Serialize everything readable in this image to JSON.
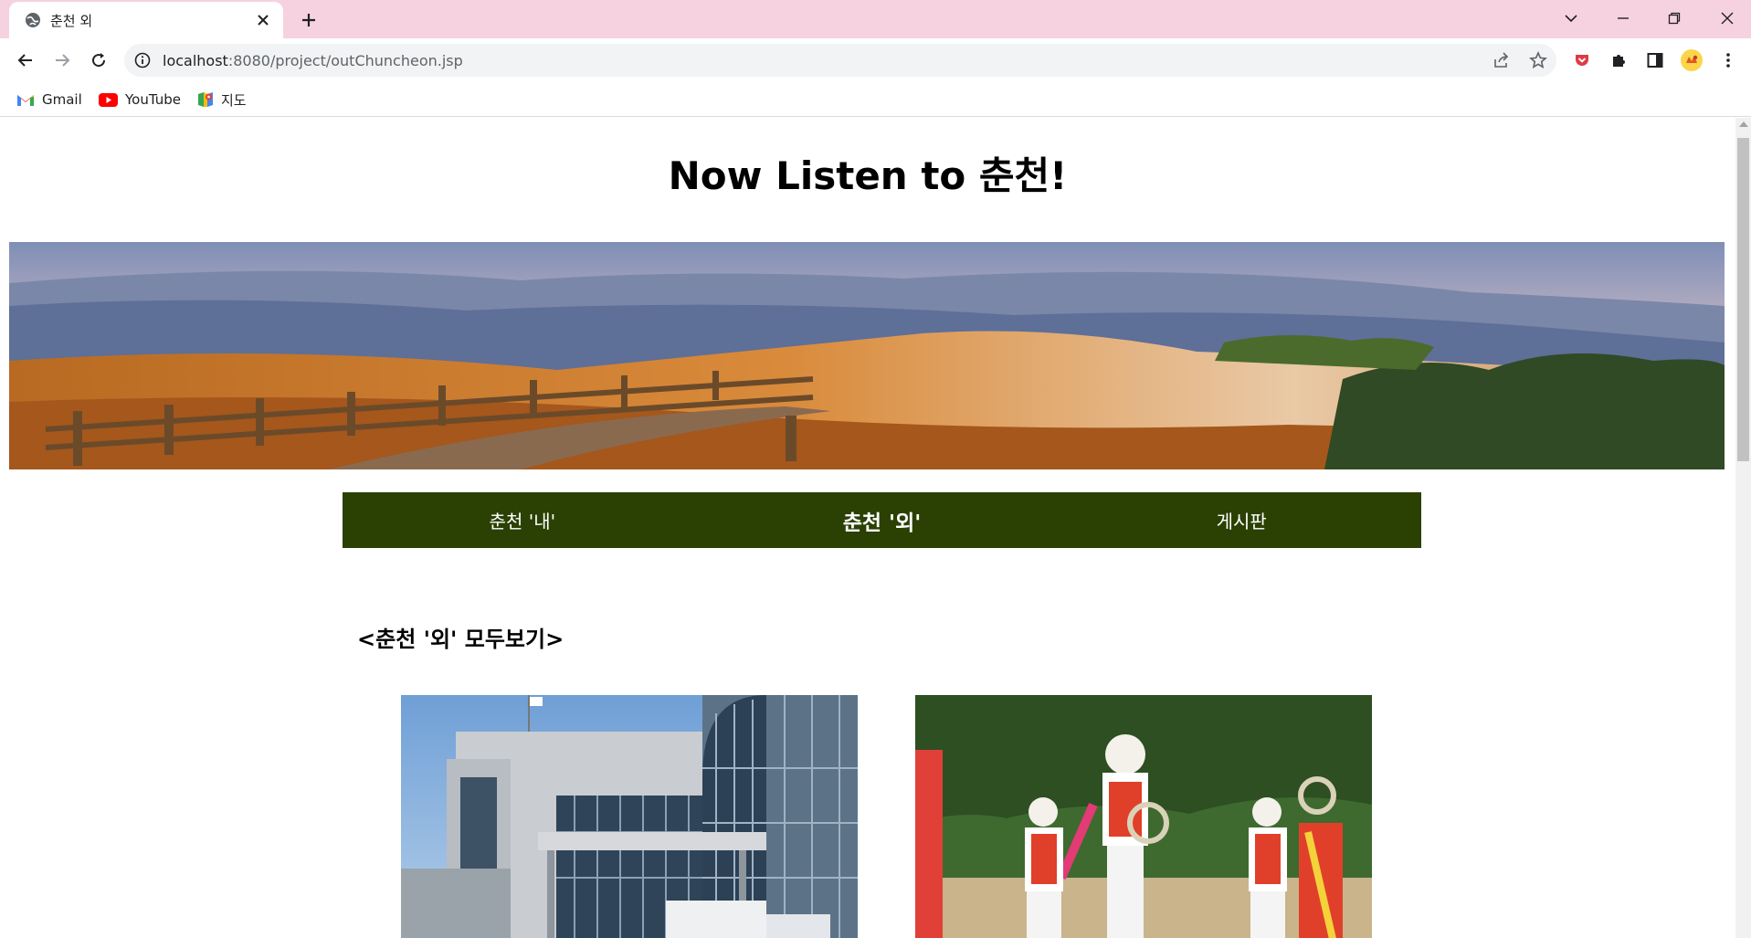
{
  "browser": {
    "tab": {
      "title": "춘천 외"
    },
    "address": {
      "host": "localhost",
      "rest": ":8080/project/outChuncheon.jsp"
    },
    "bookmarks": [
      {
        "label": "Gmail",
        "icon": "gmail-icon"
      },
      {
        "label": "YouTube",
        "icon": "youtube-icon"
      },
      {
        "label": "지도",
        "icon": "maps-icon"
      }
    ]
  },
  "page": {
    "title": "Now Listen to 춘천!",
    "banner": {
      "subject": "autumn mountain ridge with silver grass and wooden fence"
    },
    "nav": [
      {
        "label": "춘천 '내'",
        "active": false
      },
      {
        "label": "춘천 '외'",
        "active": true
      },
      {
        "label": "게시판",
        "active": false
      }
    ],
    "section_heading": "<춘천 '외' 모두보기>",
    "cards": [
      {
        "subject": "arts center building"
      },
      {
        "subject": "traditional farmers' dance performers"
      }
    ]
  },
  "colors": {
    "tabstrip": "#f6d2e1",
    "nav_bg": "#2b4003",
    "nav_text": "#ffffff"
  }
}
